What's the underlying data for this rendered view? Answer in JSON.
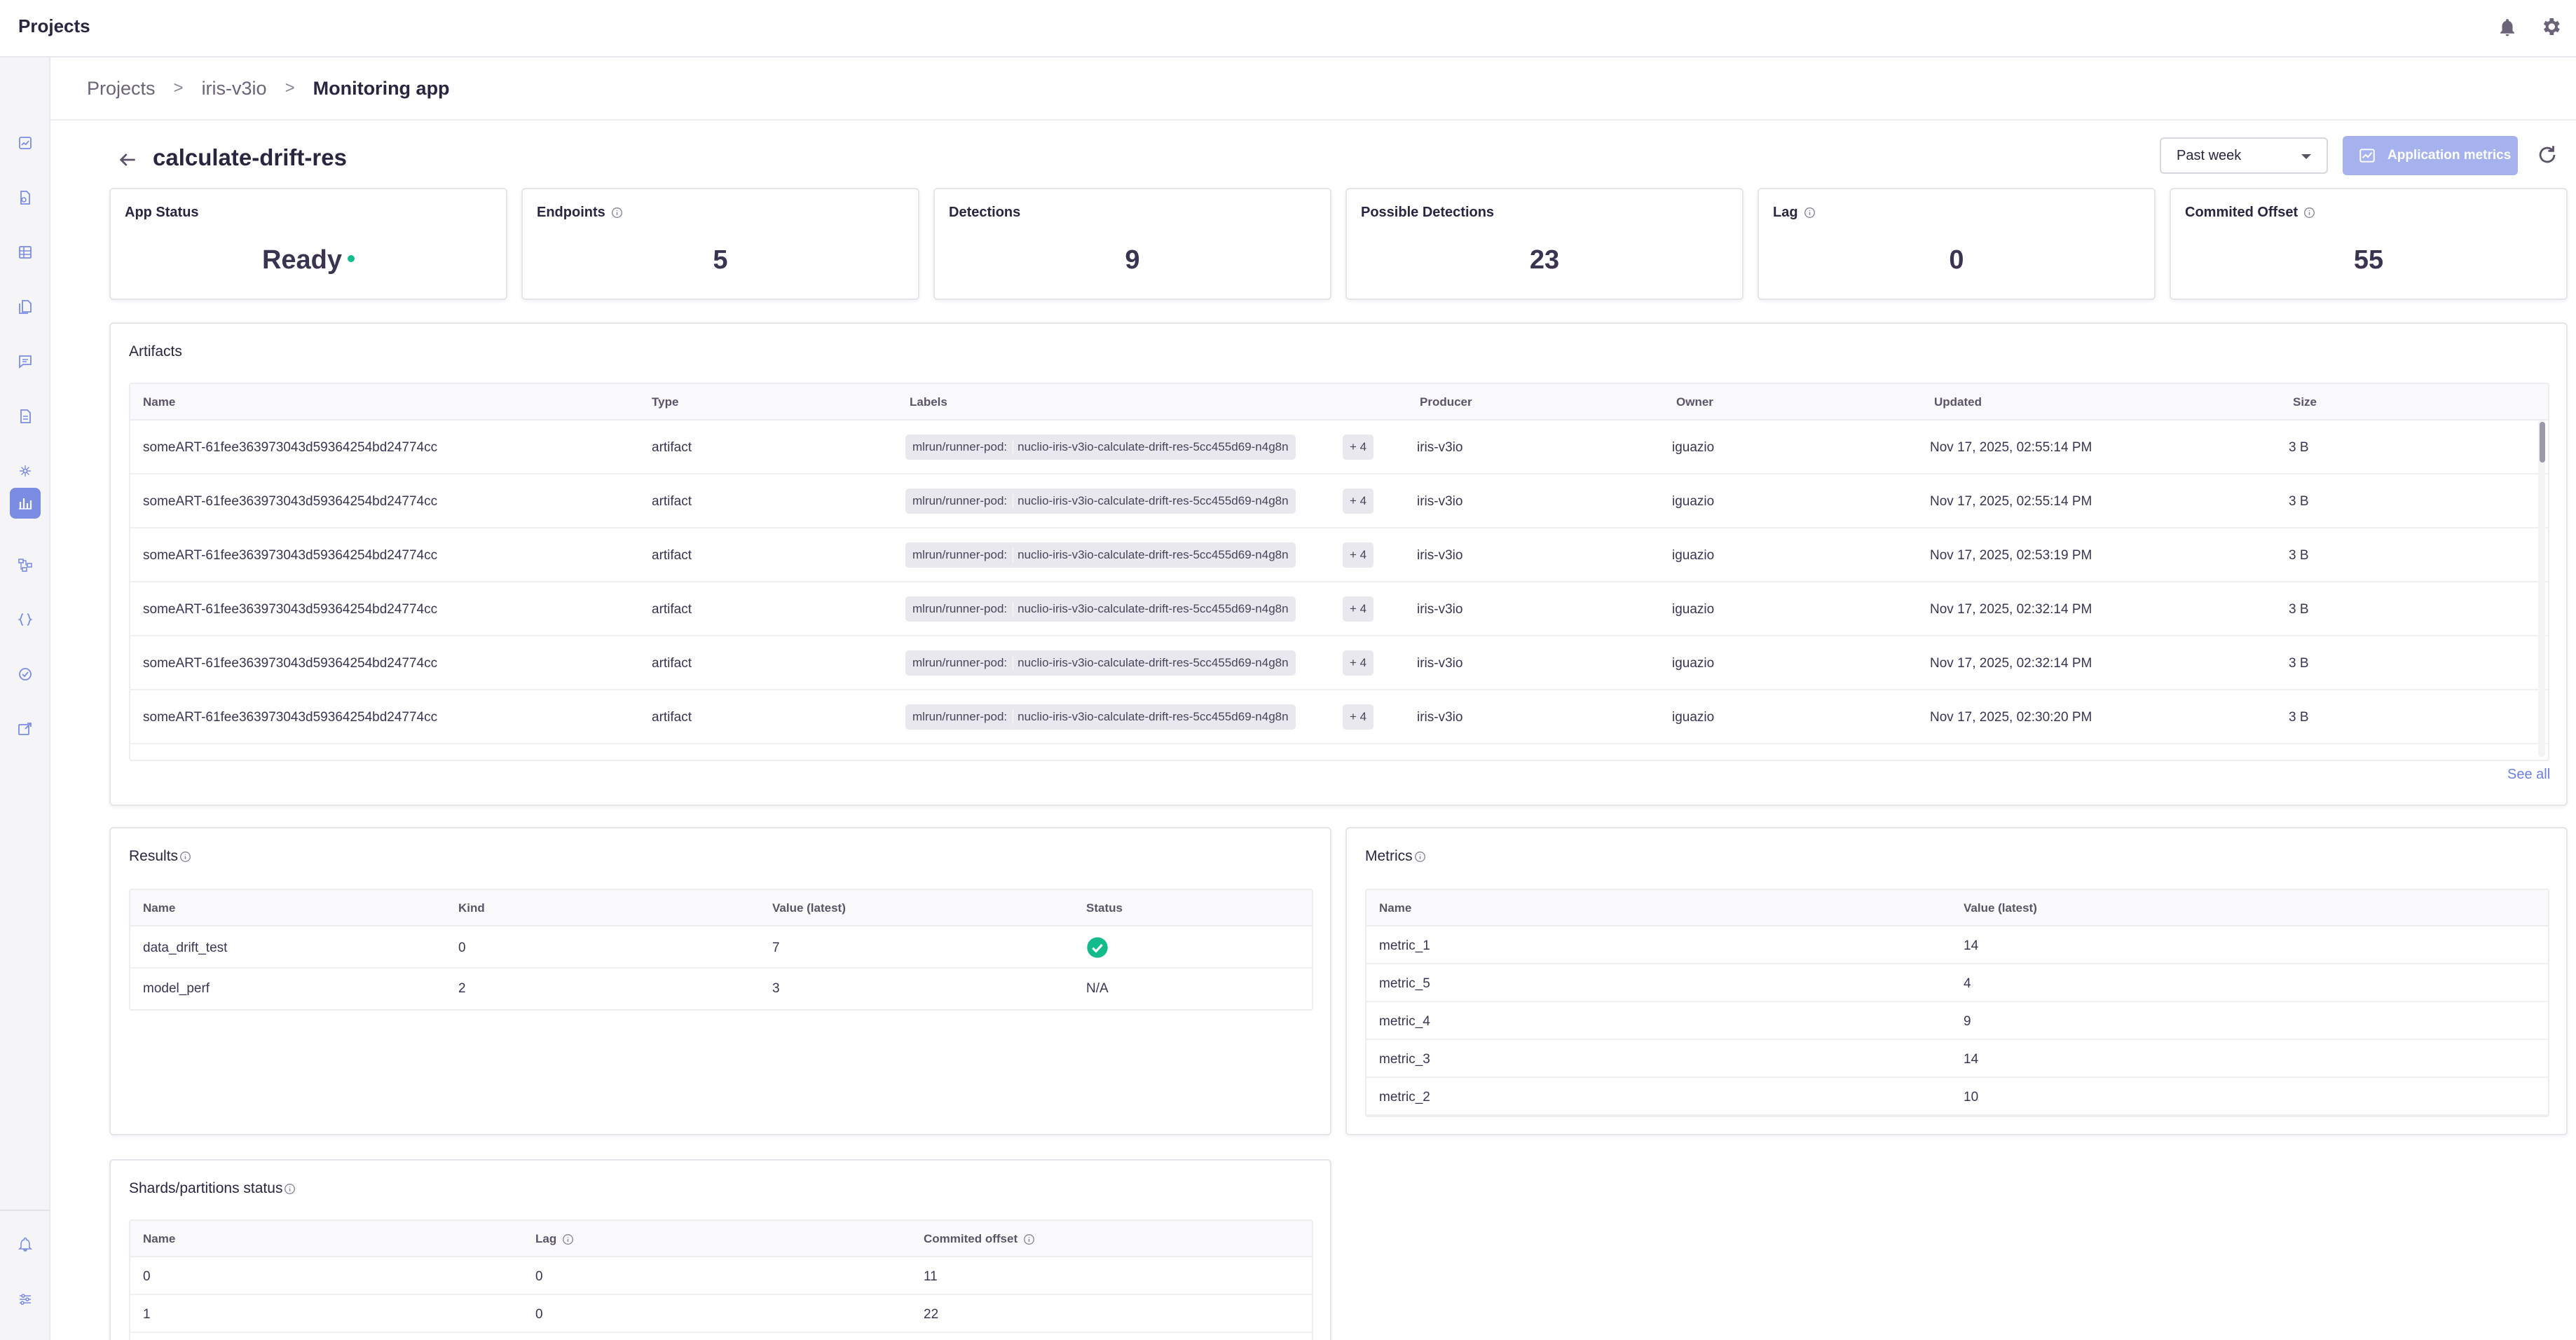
{
  "topbar": {
    "title": "Projects",
    "bell_icon": "bell-icon",
    "settings_icon": "gear-icon"
  },
  "sidenav": {
    "items": [
      {
        "icon": "dashboard-icon"
      },
      {
        "icon": "files-icon"
      },
      {
        "icon": "table-icon"
      },
      {
        "icon": "documents-icon"
      },
      {
        "icon": "chat-icon"
      },
      {
        "icon": "datasets-icon"
      },
      {
        "icon": "models-icon"
      },
      {
        "icon": "monitoring-icon",
        "active": true
      },
      {
        "icon": "workflow-icon"
      },
      {
        "icon": "functions-icon"
      },
      {
        "icon": "jobs-icon"
      },
      {
        "icon": "api-gateway-icon"
      }
    ],
    "bottom": [
      {
        "icon": "alerts-icon"
      },
      {
        "icon": "settings-sliders-icon"
      }
    ]
  },
  "breadcrumb": {
    "projects": "Projects",
    "project": "iris-v3io",
    "page": "Monitoring app",
    "separator": ">"
  },
  "header": {
    "title": "calculate-drift-res",
    "range": "Past week",
    "metrics_button": "Application metrics"
  },
  "stats": {
    "app_status": {
      "label": "App Status",
      "value": "Ready"
    },
    "endpoints": {
      "label": "Endpoints",
      "value": "5"
    },
    "detections": {
      "label": "Detections",
      "value": "9"
    },
    "possible": {
      "label": "Possible Detections",
      "value": "23"
    },
    "lag": {
      "label": "Lag",
      "value": "0"
    },
    "offset": {
      "label": "Commited Offset",
      "value": "55"
    }
  },
  "artifacts": {
    "title": "Artifacts",
    "columns": {
      "name": "Name",
      "type": "Type",
      "labels": "Labels",
      "producer": "Producer",
      "owner": "Owner",
      "updated": "Updated",
      "size": "Size"
    },
    "rows": [
      {
        "name": "someART-61fee363973043d59364254bd24774cc",
        "type": "artifact",
        "label_key": "mlrun/runner-pod:",
        "label_value": "nuclio-iris-v3io-calculate-drift-res-5cc455d69-n4g8n",
        "more": "+ 4",
        "producer": "iris-v3io",
        "owner": "iguazio",
        "updated": "Nov 17, 2025, 02:55:14 PM",
        "size": "3 B"
      },
      {
        "name": "someART-61fee363973043d59364254bd24774cc",
        "type": "artifact",
        "label_key": "mlrun/runner-pod:",
        "label_value": "nuclio-iris-v3io-calculate-drift-res-5cc455d69-n4g8n",
        "more": "+ 4",
        "producer": "iris-v3io",
        "owner": "iguazio",
        "updated": "Nov 17, 2025, 02:55:14 PM",
        "size": "3 B"
      },
      {
        "name": "someART-61fee363973043d59364254bd24774cc",
        "type": "artifact",
        "label_key": "mlrun/runner-pod:",
        "label_value": "nuclio-iris-v3io-calculate-drift-res-5cc455d69-n4g8n",
        "more": "+ 4",
        "producer": "iris-v3io",
        "owner": "iguazio",
        "updated": "Nov 17, 2025, 02:53:19 PM",
        "size": "3 B"
      },
      {
        "name": "someART-61fee363973043d59364254bd24774cc",
        "type": "artifact",
        "label_key": "mlrun/runner-pod:",
        "label_value": "nuclio-iris-v3io-calculate-drift-res-5cc455d69-n4g8n",
        "more": "+ 4",
        "producer": "iris-v3io",
        "owner": "iguazio",
        "updated": "Nov 17, 2025, 02:32:14 PM",
        "size": "3 B"
      },
      {
        "name": "someART-61fee363973043d59364254bd24774cc",
        "type": "artifact",
        "label_key": "mlrun/runner-pod:",
        "label_value": "nuclio-iris-v3io-calculate-drift-res-5cc455d69-n4g8n",
        "more": "+ 4",
        "producer": "iris-v3io",
        "owner": "iguazio",
        "updated": "Nov 17, 2025, 02:32:14 PM",
        "size": "3 B"
      },
      {
        "name": "someART-61fee363973043d59364254bd24774cc",
        "type": "artifact",
        "label_key": "mlrun/runner-pod:",
        "label_value": "nuclio-iris-v3io-calculate-drift-res-5cc455d69-n4g8n",
        "more": "+ 4",
        "producer": "iris-v3io",
        "owner": "iguazio",
        "updated": "Nov 17, 2025, 02:30:20 PM",
        "size": "3 B"
      }
    ],
    "see_all": "See all"
  },
  "results": {
    "title": "Results",
    "columns": {
      "name": "Name",
      "kind": "Kind",
      "value": "Value (latest)",
      "status": "Status"
    },
    "rows": [
      {
        "name": "data_drift_test",
        "kind": "0",
        "value": "7",
        "status": "",
        "status_icon": "check-circle-icon"
      },
      {
        "name": "model_perf",
        "kind": "2",
        "value": "3",
        "status": "N/A"
      }
    ]
  },
  "metrics": {
    "title": "Metrics",
    "columns": {
      "name": "Name",
      "value": "Value (latest)"
    },
    "rows": [
      {
        "name": "metric_1",
        "value": "14"
      },
      {
        "name": "metric_5",
        "value": "4"
      },
      {
        "name": "metric_4",
        "value": "9"
      },
      {
        "name": "metric_3",
        "value": "14"
      },
      {
        "name": "metric_2",
        "value": "10"
      }
    ]
  },
  "shards": {
    "title": "Shards/partitions status",
    "columns": {
      "name": "Name",
      "lag": "Lag",
      "offset": "Commited offset"
    },
    "rows": [
      {
        "name": "0",
        "lag": "0",
        "offset": "11"
      },
      {
        "name": "1",
        "lag": "0",
        "offset": "22"
      }
    ]
  },
  "colors": {
    "accent": "#7b8de3",
    "button": "#a5b2ee",
    "success": "#13bb8a",
    "link": "#6d7fe0"
  }
}
